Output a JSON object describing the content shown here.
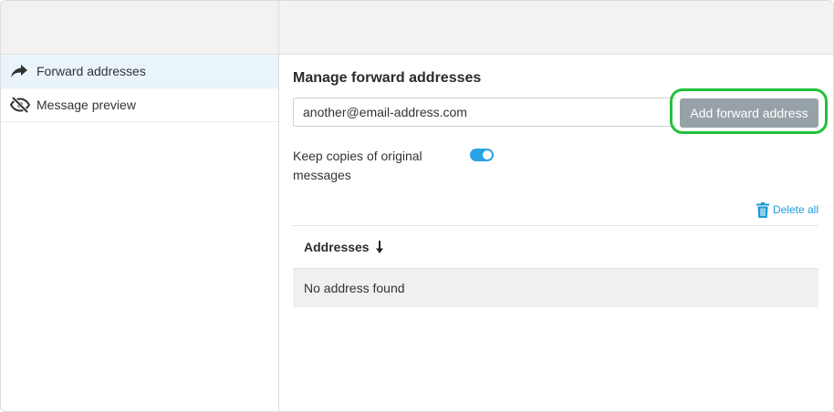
{
  "sidebar": {
    "items": [
      {
        "label": "Forward addresses",
        "icon": "share-arrow-icon",
        "active": true
      },
      {
        "label": "Message preview",
        "icon": "eye-slash-icon",
        "active": false
      }
    ]
  },
  "main": {
    "title": "Manage forward addresses",
    "email_input": {
      "value": "another@email-address.com",
      "placeholder": ""
    },
    "add_button_label": "Add forward address",
    "keep_copies": {
      "label": "Keep copies of original messages",
      "enabled": true
    },
    "delete_all_label": "Delete all",
    "table": {
      "column_header": "Addresses",
      "sort_direction": "descending",
      "empty_message": "No address found"
    }
  },
  "colors": {
    "accent": "#2aa3e6",
    "link": "#1e9ad6",
    "button_bg": "#97a2a8",
    "highlight": "#22c13c",
    "active_item_bg": "#eaf4fb"
  }
}
